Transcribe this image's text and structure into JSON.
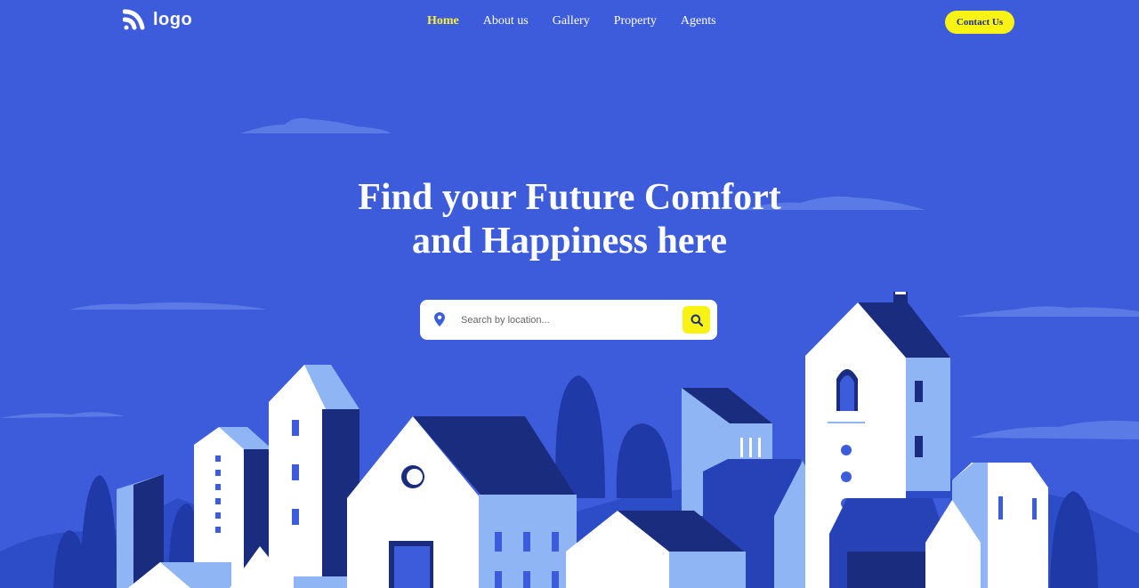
{
  "header": {
    "logo_text": "logo",
    "nav": [
      "Home",
      "About us",
      "Gallery",
      "Property",
      "Agents"
    ],
    "active_nav": "Home",
    "contact_label": "Contact Us"
  },
  "hero": {
    "title_line1": "Find your Future Comfort",
    "title_line2": "and Happiness here",
    "search_placeholder": "Search by location..."
  },
  "colors": {
    "background": "#3d5cdc",
    "accent": "#f8f313",
    "navy": "#1a2c7e",
    "light_blue": "#8fb5f4"
  }
}
